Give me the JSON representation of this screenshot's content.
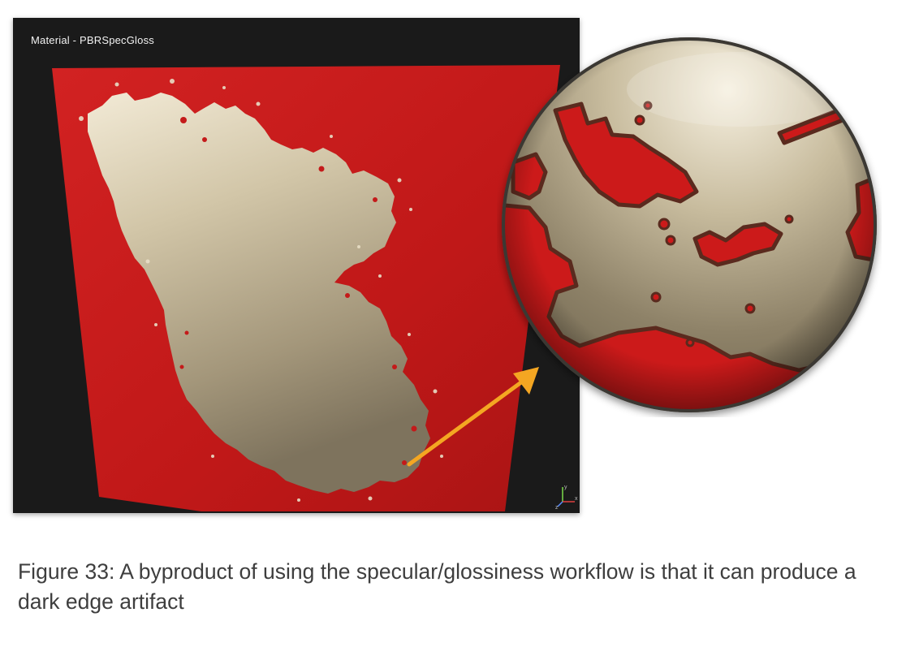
{
  "viewport": {
    "title": "Material - PBRSpecGloss"
  },
  "colors": {
    "viewport_bg": "#1a1a1a",
    "red_surface": "#c41a1a",
    "metal_light": "#e6dcc4",
    "metal_dark": "#7a7058",
    "arrow": "#f4a622",
    "caption_text": "#3e3e3e"
  },
  "axis_gizmo": {
    "x_label": "x",
    "y_label": "y",
    "z_label": "z"
  },
  "caption": {
    "text": "Figure 33: A byproduct of using the specular/glossiness workflow is that it can produce a dark edge artifact"
  }
}
